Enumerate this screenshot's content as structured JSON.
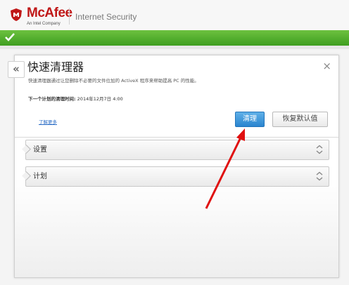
{
  "header": {
    "brand": "McAfee",
    "brand_sub": "An Intel Company",
    "product": "Internet Security"
  },
  "panel": {
    "back_label": "«",
    "close_label": "×",
    "title": "快速清理器",
    "description": "快速清理器通过让您删除不必要的文件位加的 ActiveX 程序来帮助提高 PC 的性能。",
    "schedule_label": "下一个计划的清理时间:",
    "schedule_value": " 2014年12月7日 4:00",
    "learn_more": "了解更多",
    "clean_button": "清理",
    "restore_button": "恢复默认值"
  },
  "sections": [
    {
      "label": "设置"
    },
    {
      "label": "计划"
    }
  ],
  "colors": {
    "brand_red": "#c01818",
    "status_green": "#4aa82a",
    "primary_blue": "#2a85cf",
    "annotation_red": "#e01010"
  },
  "icons": [
    "mcafee-shield-icon",
    "check-icon",
    "chevron-up-down-icon"
  ]
}
